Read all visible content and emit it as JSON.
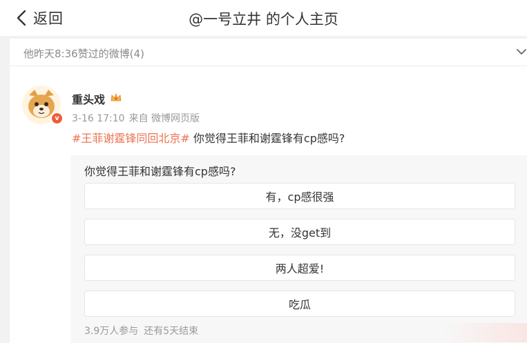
{
  "nav": {
    "back_label": "返回",
    "title": "@一号立井 的个人主页"
  },
  "liked": {
    "header_text": "他昨天8:36赞过的微博(4)"
  },
  "post": {
    "username": "重头戏",
    "time": "3-16 17:10",
    "source": "来自 微博网页版",
    "hashtag": "#王菲谢霆锋同回北京#",
    "text": " 你觉得王菲和谢霆锋有cp感吗?",
    "verified_mark": "v"
  },
  "poll": {
    "question": "你觉得王菲和谢霆锋有cp感吗?",
    "options": [
      {
        "label": "有，cp感很强"
      },
      {
        "label": "无，没get到"
      },
      {
        "label": "两人超爱!"
      },
      {
        "label": "吃瓜"
      }
    ],
    "participants": "3.9万人参与",
    "time_left": "还有5天结束"
  },
  "colors": {
    "hashtag": "#eb7350",
    "verified": "#ef5b3a",
    "muted_text": "#999999"
  },
  "icons": [
    "chevron-left-icon",
    "chevron-down-icon",
    "crown-icon",
    "verified-icon"
  ]
}
